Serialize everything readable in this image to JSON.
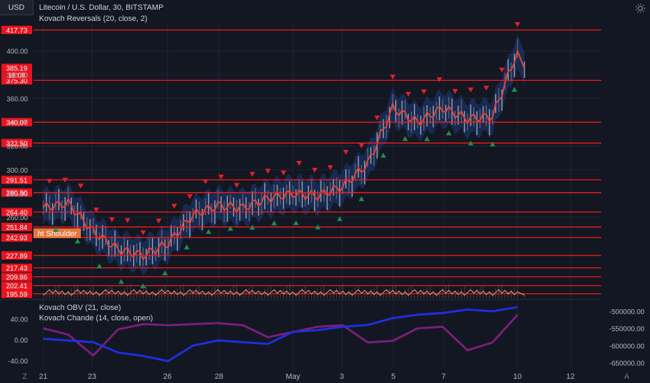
{
  "header": {
    "currency": "USD",
    "title": "Litecoin / U.S. Dollar, 30, BITSTAMP",
    "indicator_main": "Kovach Reversals (20, close, 2)",
    "indicator_obv": "Kovach OBV (21, close)",
    "indicator_chande": "Kovach Chande (14, close, open)",
    "pattern_label": "ht Shoulder",
    "time_left": "16:06",
    "corner_left": "Z",
    "corner_right": "A"
  },
  "colors": {
    "background": "#131722",
    "level_line": "#ff1a1a",
    "level_label": "#e8141f",
    "candle_band": "#1c3a7a",
    "signal_ma": "#e0453d",
    "buy_marker": "#1e8c4e",
    "sell_marker": "#e0202d",
    "obv": "#1f2fe0",
    "chande": "#7a1f7a",
    "pattern_label_bg": "#e6763a"
  },
  "chart_data": [
    {
      "type": "line",
      "title": "Litecoin / U.S. Dollar, 30, BITSTAMP",
      "yaxis_ticks": [
        260.0,
        280.0,
        300.0,
        320.0,
        340.0,
        360.0,
        380.0,
        400.0
      ],
      "ylim": [
        192,
        423
      ],
      "xaxis_ticks": [
        "21",
        "23",
        "26",
        "28",
        "May",
        "3",
        "5",
        "7",
        "10",
        "12"
      ],
      "horizontal_levels": [
        417.73,
        375.3,
        340.07,
        322.5,
        291.51,
        280.8,
        264.4,
        251.84,
        242.93,
        227.89,
        217.43,
        209.86,
        202.41,
        195.59
      ],
      "last_price": 385.19,
      "series": [
        {
          "name": "",
          "x": [
            "21",
            "22",
            "23",
            "24",
            "25",
            "26",
            "27",
            "28",
            "29",
            "30",
            "May",
            "2",
            "3",
            "4",
            "5",
            "6",
            "7",
            "8",
            "9",
            "10"
          ],
          "values": [
            268,
            272,
            248,
            233,
            228,
            238,
            262,
            270,
            268,
            276,
            280,
            278,
            286,
            305,
            352,
            340,
            352,
            343,
            345,
            400
          ]
        }
      ]
    },
    {
      "type": "line",
      "yaxis_left_ticks": [
        40.0,
        0.0,
        -40.0
      ],
      "yaxis_right_ticks": [
        -500000.0,
        -550000.0,
        -600000.0,
        -650000.0
      ],
      "series": [
        {
          "name": "Kovach OBV (21, close)",
          "x": [
            "21",
            "22",
            "23",
            "24",
            "25",
            "26",
            "27",
            "28",
            "29",
            "30",
            "May",
            "2",
            "3",
            "4",
            "5",
            "6",
            "7",
            "8",
            "9",
            "10"
          ],
          "values": [
            -580000,
            -585000,
            -590000,
            -620000,
            -630000,
            -645000,
            -600000,
            -585000,
            -590000,
            -595000,
            -560000,
            -555000,
            -545000,
            -540000,
            -520000,
            -510000,
            -505000,
            -495000,
            -500000,
            -488000
          ]
        },
        {
          "name": "Kovach Chande (14, close, open)",
          "x": [
            "21",
            "22",
            "23",
            "24",
            "25",
            "26",
            "27",
            "28",
            "29",
            "30",
            "May",
            "2",
            "3",
            "4",
            "5",
            "6",
            "7",
            "8",
            "9",
            "10"
          ],
          "values": [
            22,
            10,
            -30,
            20,
            30,
            28,
            30,
            32,
            28,
            5,
            15,
            25,
            28,
            -5,
            -2,
            22,
            25,
            -20,
            -5,
            48
          ]
        }
      ]
    }
  ]
}
